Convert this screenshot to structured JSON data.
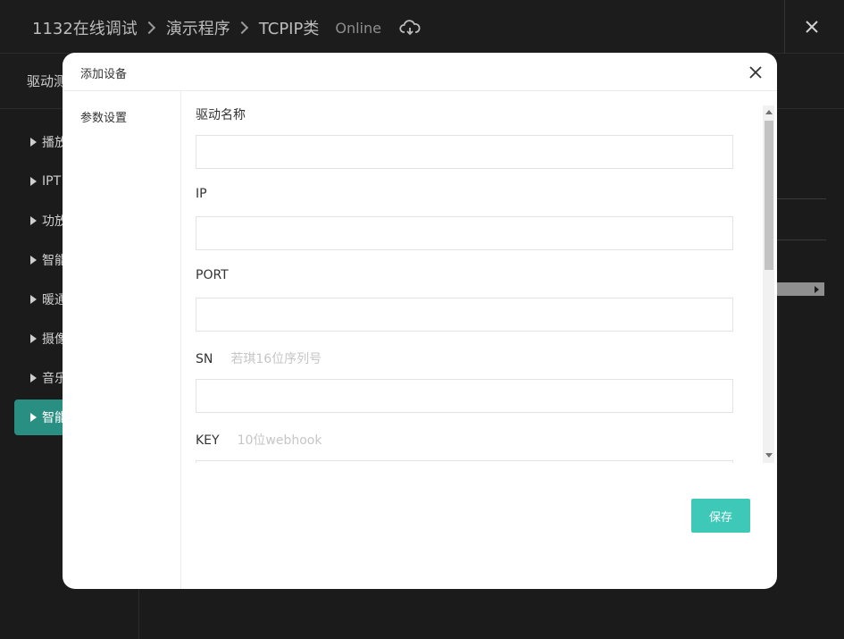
{
  "app": {
    "breadcrumb": [
      "1132在线调试",
      "演示程序",
      "TCPIP类"
    ],
    "status": "Online",
    "subbar_title": "驱动测",
    "sidebar_items": [
      "播放",
      "IPT",
      "功放",
      "智能",
      "暖通",
      "摄像",
      "音乐",
      "智能"
    ],
    "active_sidebar_index": 7
  },
  "modal": {
    "title": "添加设备",
    "nav": [
      "参数设置"
    ],
    "fields": [
      {
        "label": "驱动名称",
        "hint": "",
        "value": ""
      },
      {
        "label": "IP",
        "hint": "",
        "value": ""
      },
      {
        "label": "PORT",
        "hint": "",
        "value": ""
      },
      {
        "label": "SN",
        "hint": "若琪16位序列号",
        "value": ""
      },
      {
        "label": "KEY",
        "hint": "10位webhook",
        "value": ""
      }
    ],
    "save_label": "保存"
  },
  "colors": {
    "accent": "#3ec8b7",
    "active_sidebar": "#2a8f83",
    "overlay_bg": "#1b1b1b"
  }
}
